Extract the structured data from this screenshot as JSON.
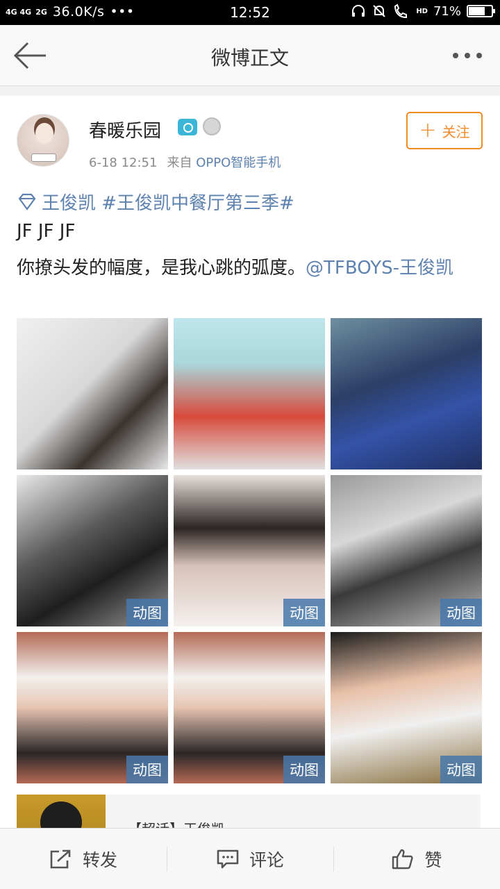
{
  "status_bar": {
    "signal_1": "4G 4G",
    "signal_2": "2G",
    "net_speed": "36.0K/s",
    "dots": "•••",
    "time": "12:52",
    "hd": "HD",
    "battery": "71%",
    "battery_level": 0.71
  },
  "nav": {
    "title": "微博正文"
  },
  "post": {
    "username": "春暖乐园",
    "time": "6-18 12:51",
    "from_label": "来自",
    "device": "OPPO智能手机",
    "follow_label": "关注",
    "topics": "王俊凯 #王俊凯中餐厅第三季#",
    "line1": "JF JF JF",
    "text": "你撩头发的幅度，是我心跳的弧度。",
    "mention": "@TFBOYS-王俊凯",
    "gif_label": "动图",
    "card_title": "【超话】王俊凯"
  },
  "images": [
    {
      "name": "photo-1",
      "gif": false
    },
    {
      "name": "photo-2",
      "gif": false
    },
    {
      "name": "photo-3",
      "gif": false
    },
    {
      "name": "photo-4",
      "gif": true
    },
    {
      "name": "photo-5",
      "gif": true
    },
    {
      "name": "photo-6",
      "gif": true
    },
    {
      "name": "photo-7",
      "gif": true
    },
    {
      "name": "photo-8",
      "gif": true
    },
    {
      "name": "photo-9",
      "gif": true
    }
  ],
  "actions": {
    "repost": "转发",
    "comment": "评论",
    "like": "赞"
  },
  "colors": {
    "link": "#5e82b0",
    "follow": "#f28c28"
  }
}
